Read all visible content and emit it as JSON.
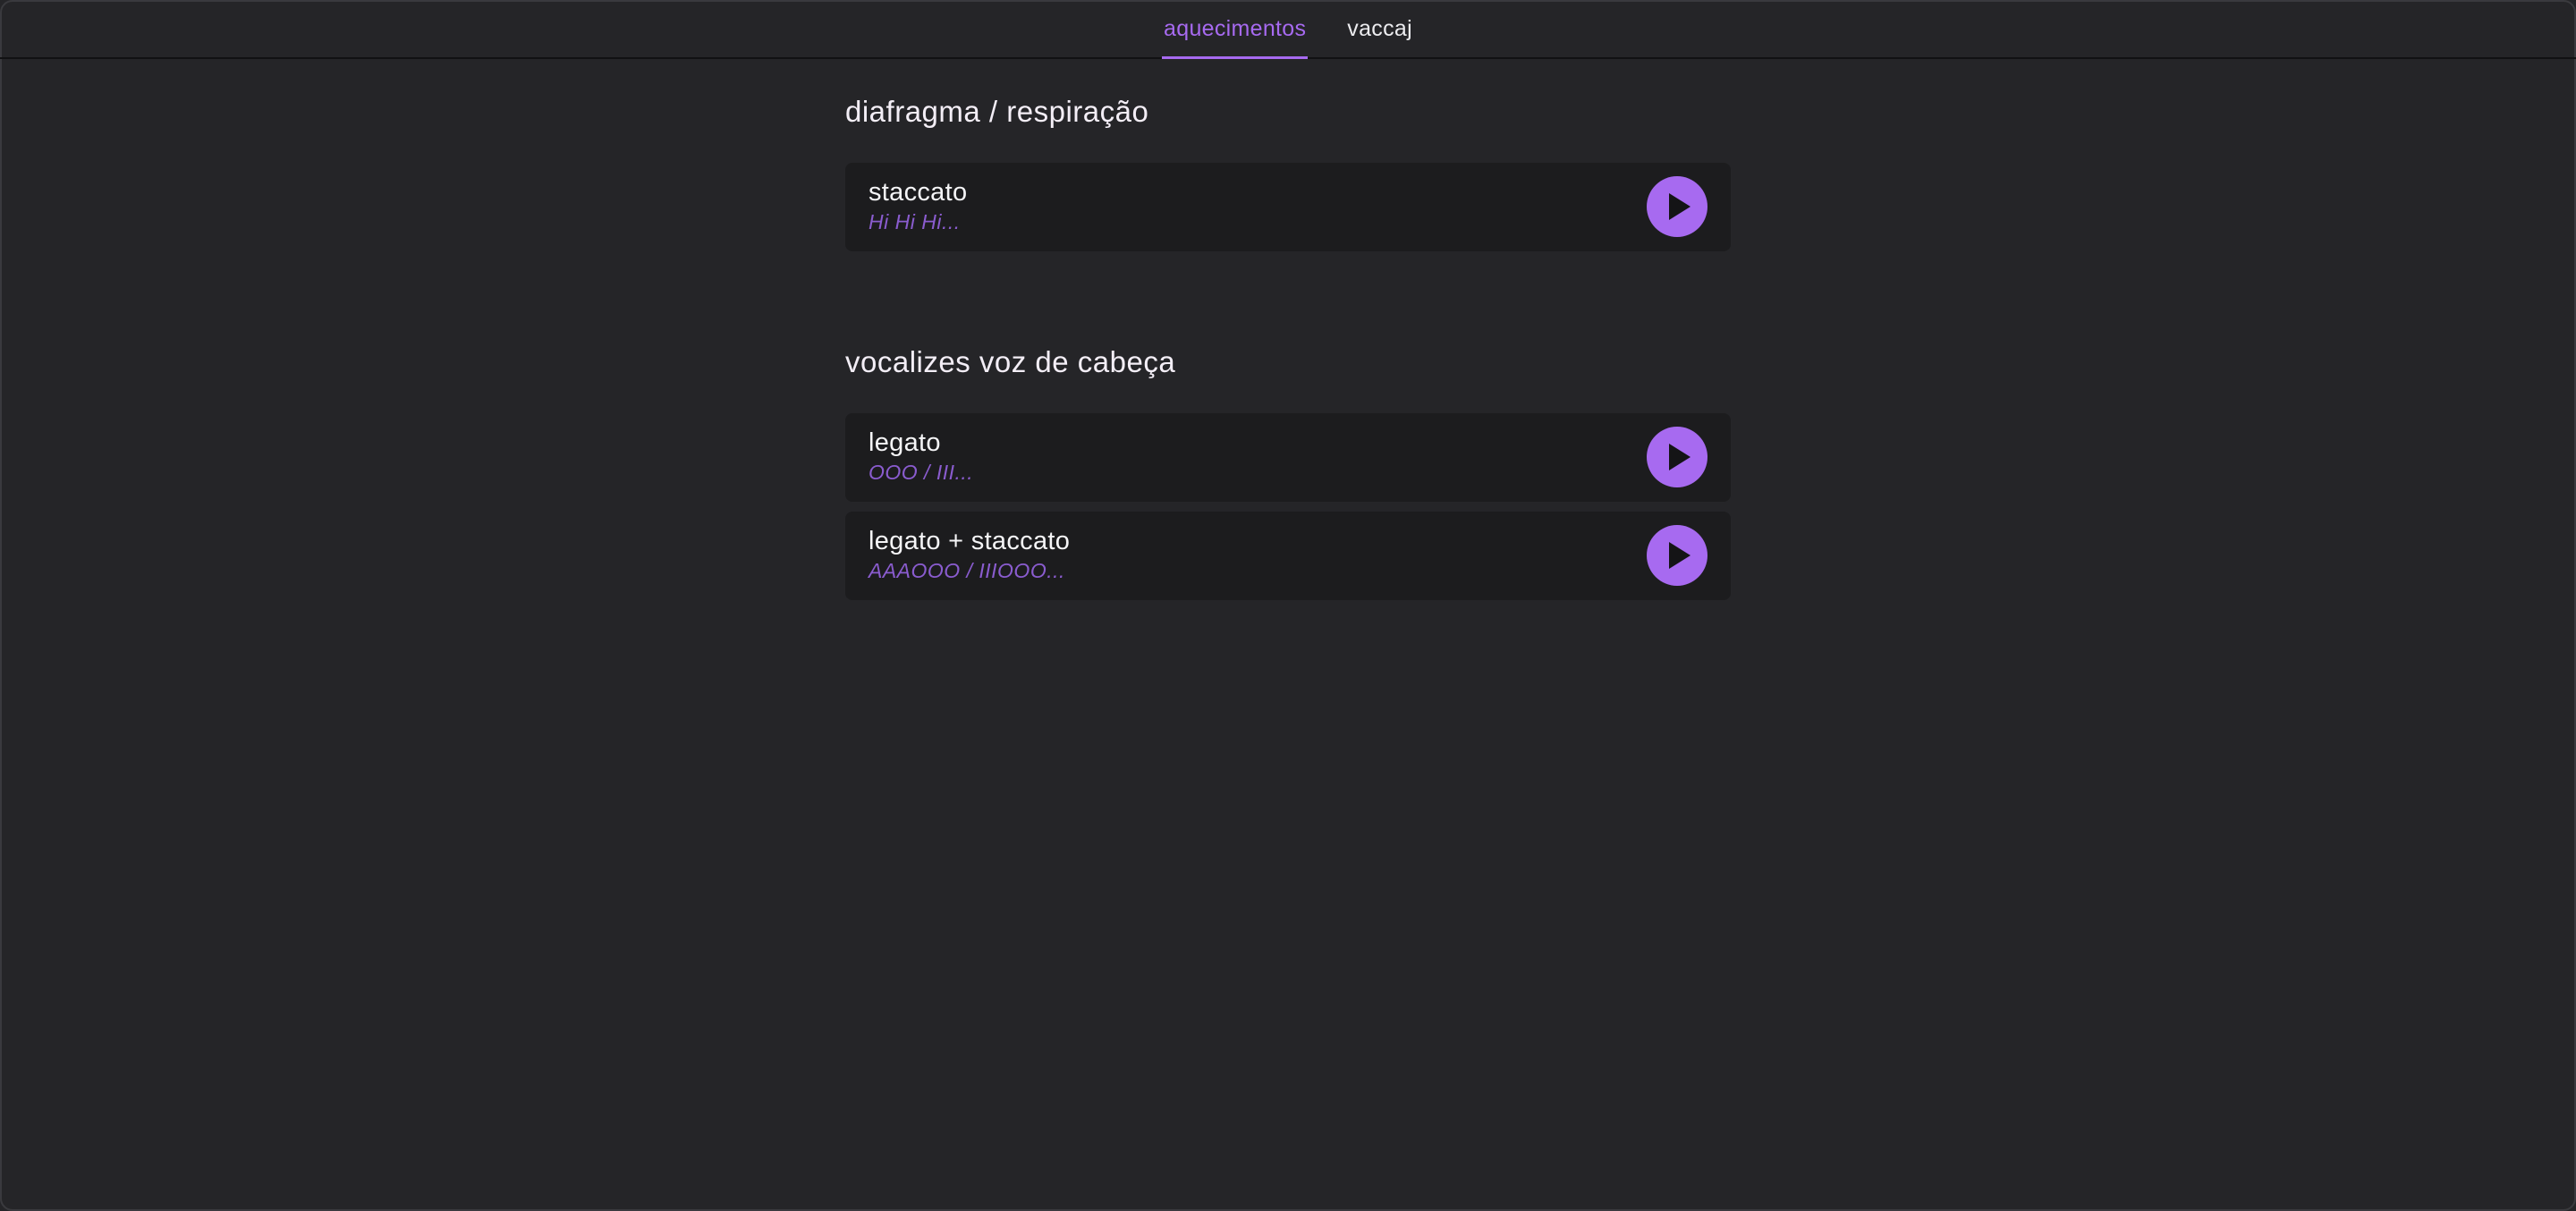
{
  "nav": {
    "tabs": [
      {
        "label": "aquecimentos",
        "active": true
      },
      {
        "label": "vaccaj",
        "active": false
      }
    ]
  },
  "sections": [
    {
      "title": "diafragma / respiração",
      "items": [
        {
          "title": "staccato",
          "subtitle": "Hi Hi Hi...",
          "action_icon": "play-icon"
        }
      ]
    },
    {
      "title": "vocalizes voz de cabeça",
      "items": [
        {
          "title": "legato",
          "subtitle": "OOO / III...",
          "action_icon": "play-icon"
        },
        {
          "title": "legato + staccato",
          "subtitle": "AAAOOO / IIIOOO...",
          "action_icon": "play-icon"
        }
      ]
    }
  ],
  "colors": {
    "accent": "#a76af0",
    "background": "#252528",
    "card": "#1c1c1e",
    "subtitle": "#8a5ccf"
  }
}
